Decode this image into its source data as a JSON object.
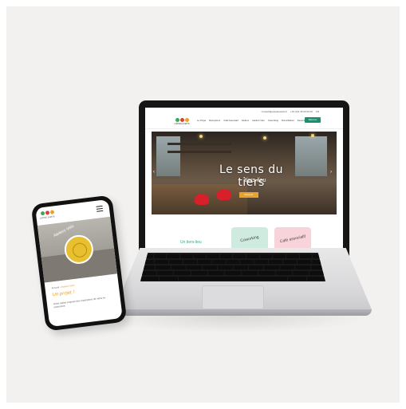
{
  "laptop": {
    "site": {
      "topbar": [
        "contact@epicedesarts.fr",
        "+33 (0)1 45 00 00 00",
        "FR"
      ],
      "logo_text": "L'ÉPICE & ARTS",
      "nav": [
        "Le Projet",
        "Réceptions",
        "Café Associatif",
        "Ateliers",
        "Ateliers Vélo",
        "Coworking",
        "Domiciliation",
        "Devenir bénévole"
      ],
      "cta": "Réserver",
      "hero_title": "Le sens du tiers",
      "hero_subtitle": "tiers-lieu",
      "hero_button": "Découvrir",
      "section_heading": "Un tiers-lieu",
      "card_1_text": "Coworking",
      "card_2_text": "Café associatif"
    }
  },
  "phone": {
    "logo_text": "L'ÉPICE & ARTS",
    "badge_text": "Ateliers Vélo",
    "breadcrumb_prefix": "Accueil",
    "breadcrumb_current": "Ateliers Vélo",
    "heading": "Un projet !",
    "paragraph": "Notre atelier propose des réparations de vélos en autonomie."
  },
  "colors": {
    "dot_1": "#3aa857",
    "dot_2": "#d8432c",
    "dot_3": "#e8a22b",
    "accent_green": "#1c8f6c",
    "accent_orange": "#e8a22b",
    "card_1": "#cfeadf",
    "card_2": "#f8d4da"
  },
  "icons": {
    "menu": "hamburger-icon",
    "arrows": "chevron-icon"
  }
}
